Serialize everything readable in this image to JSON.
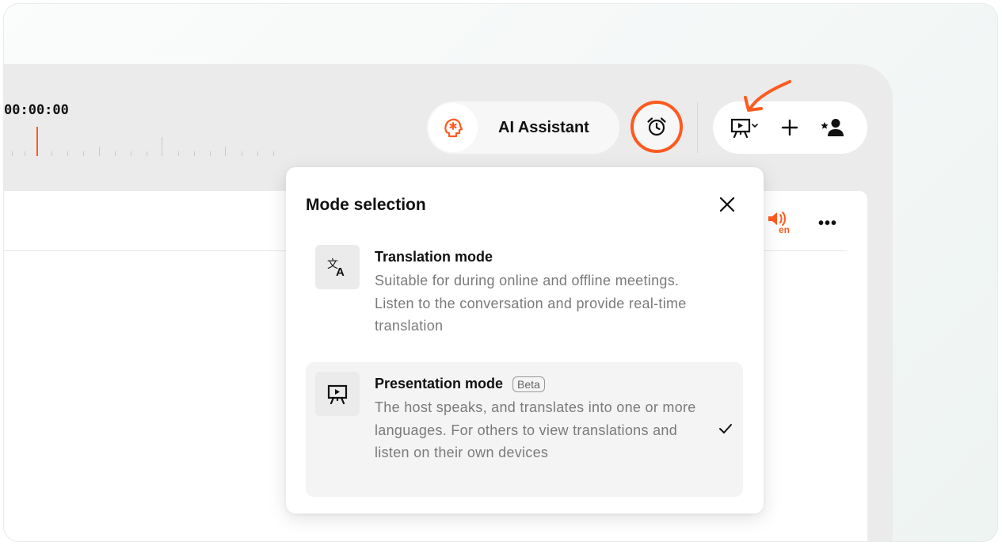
{
  "timeline": {
    "time": "00:00:00"
  },
  "header": {
    "ai_assistant_label": "AI Assistant"
  },
  "panel": {
    "speaker_lang": "en",
    "more_label": "•••"
  },
  "modal": {
    "title": "Mode selection",
    "options": [
      {
        "title": "Translation mode",
        "description": "Suitable for during online and offline meetings. Listen to the conversation and provide real-time translation",
        "selected": false,
        "icon": "translate-icon"
      },
      {
        "title": "Presentation mode",
        "badge": "Beta",
        "description": "The host speaks, and translates into one or more languages. For others to view translations and listen on their own devices",
        "selected": true,
        "icon": "presentation-icon"
      }
    ]
  },
  "colors": {
    "accent": "#ff5a1f",
    "app_background": "#ebebeb",
    "selected_option": "#f4f4f4"
  }
}
